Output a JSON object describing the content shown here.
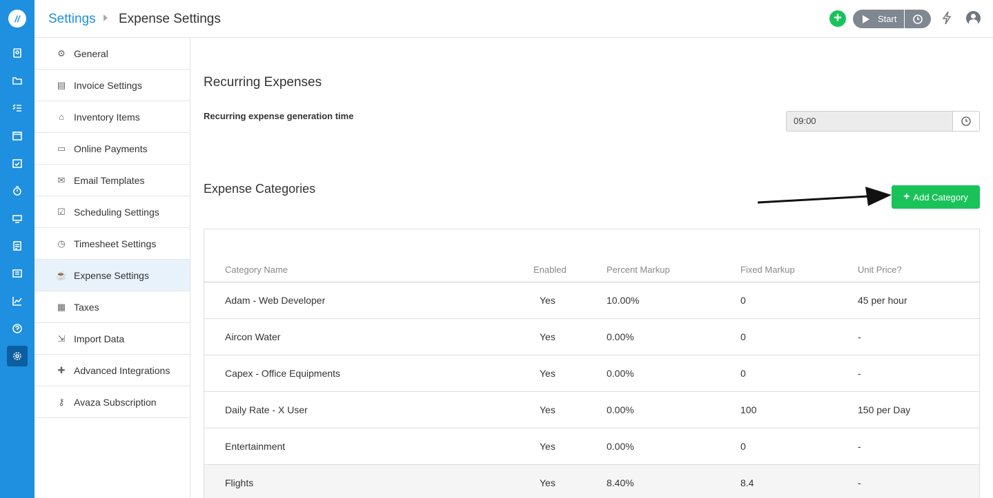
{
  "header": {
    "breadcrumb_root": "Settings",
    "breadcrumb_current": "Expense Settings",
    "start_label": "Start"
  },
  "rail": {
    "icons": [
      "logo-icon",
      "contacts-icon",
      "folder-icon",
      "tasks-icon",
      "calendar-icon",
      "schedule-icon",
      "timer-icon",
      "expense-icon",
      "invoice-icon",
      "reports-list-icon",
      "chart-icon",
      "help-icon",
      "gear-icon"
    ]
  },
  "subnav": {
    "items": [
      {
        "label": "General",
        "icon": "cogs-icon"
      },
      {
        "label": "Invoice Settings",
        "icon": "invoice-icon"
      },
      {
        "label": "Inventory Items",
        "icon": "basket-icon"
      },
      {
        "label": "Online Payments",
        "icon": "credit-card-icon"
      },
      {
        "label": "Email Templates",
        "icon": "envelope-icon"
      },
      {
        "label": "Scheduling Settings",
        "icon": "calendar-check-icon"
      },
      {
        "label": "Timesheet Settings",
        "icon": "clock-icon"
      },
      {
        "label": "Expense Settings",
        "icon": "coffee-icon"
      },
      {
        "label": "Taxes",
        "icon": "calculator-icon"
      },
      {
        "label": "Import Data",
        "icon": "import-icon"
      },
      {
        "label": "Advanced Integrations",
        "icon": "puzzle-icon"
      },
      {
        "label": "Avaza Subscription",
        "icon": "key-icon"
      }
    ],
    "active_index": 7
  },
  "recurring": {
    "title": "Recurring Expenses",
    "label": "Recurring expense generation time",
    "time_value": "09:00"
  },
  "categories": {
    "title": "Expense Categories",
    "add_button": "Add Category",
    "columns": [
      "Category Name",
      "Enabled",
      "Percent Markup",
      "Fixed Markup",
      "Unit Price?"
    ],
    "rows": [
      [
        "Adam - Web Developer",
        "Yes",
        "10.00%",
        "0",
        "45 per hour"
      ],
      [
        "Aircon Water",
        "Yes",
        "0.00%",
        "0",
        "-"
      ],
      [
        "Capex - Office Equipments",
        "Yes",
        "0.00%",
        "0",
        "-"
      ],
      [
        "Daily Rate - X User",
        "Yes",
        "0.00%",
        "100",
        "150 per Day"
      ],
      [
        "Entertainment",
        "Yes",
        "0.00%",
        "0",
        "-"
      ],
      [
        "Flights",
        "Yes",
        "8.40%",
        "8.4",
        "-"
      ]
    ]
  },
  "colors": {
    "brand_blue": "#1f8fe0",
    "success_green": "#19c35a"
  }
}
